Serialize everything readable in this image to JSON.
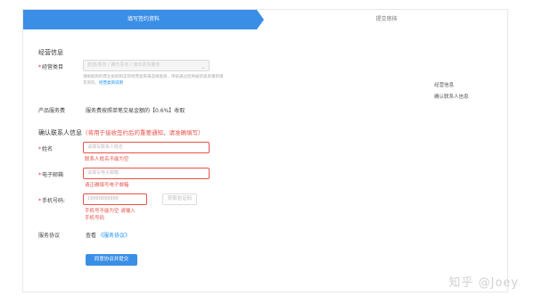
{
  "steps": {
    "active": "填写签约资料",
    "next": "提交审核"
  },
  "business": {
    "section_title": "经营信息",
    "category_label": "经营类目",
    "category_placeholder": "旅游/票务 / 娱乐票务 / 演出票务服务",
    "hint_text": "请根据你的营业执照和实际经营类目来选择类目，审核通过后将被新类目重新填充资料，",
    "hint_link": "经营类目说明",
    "service_fee_label": "产品服务费",
    "service_fee_value": "服务费按照单笔交易金额的【0.6%】收取"
  },
  "contact": {
    "section_title": "确认联系人信息",
    "section_note": "（将用于接收签约后的重要通知，请准确填写）",
    "name_label": "姓名",
    "name_placeholder": "请填写联系人姓名",
    "name_error": "联系人姓名不能为空",
    "email_label": "电子邮箱",
    "email_placeholder": "请填写电子邮箱",
    "email_error": "请正确填写电子邮箱",
    "phone_label": "手机号码:",
    "phone_value": "18888888888",
    "sms_button": "获取验证码",
    "phone_error_line1": "手机号不能为空 请输入",
    "phone_error_line2": "手机号码"
  },
  "agreement": {
    "label": "服务协议",
    "prefix": "查看",
    "link": "《服务协议》",
    "submit_button": "同意协议并提交"
  },
  "side_nav": {
    "items": [
      "经营信息",
      "确认联系人信息"
    ]
  },
  "watermark": "知乎 @Joey",
  "colors": {
    "primary": "#3a8ee6",
    "error": "#e9504a",
    "link": "#1890ff"
  }
}
